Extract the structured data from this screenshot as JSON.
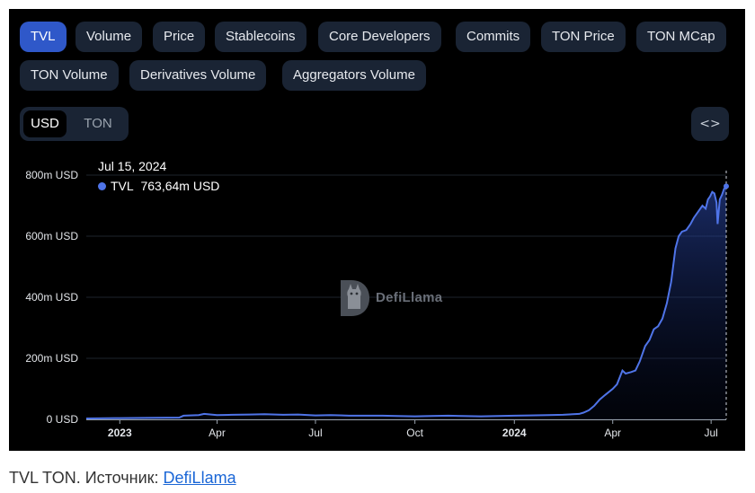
{
  "tabs": [
    "TVL",
    "Volume",
    "Price",
    "Stablecoins",
    "Core Developers",
    "Commits",
    "TON Price",
    "TON MCap",
    "TON Volume",
    "Derivatives Volume",
    "Aggregators Volume"
  ],
  "active_tab": "TVL",
  "currency_toggle": {
    "options": [
      "USD",
      "TON"
    ],
    "selected": "USD"
  },
  "embed_icon": "code-brackets-icon",
  "tooltip": {
    "date": "Jul 15, 2024",
    "series": "TVL",
    "value": "763,64m USD"
  },
  "watermark": {
    "text": "DefiLlama",
    "icon": "llama-logo-icon"
  },
  "caption": {
    "text": "TVL TON. Источник: ",
    "link_text": "DefiLlama"
  },
  "colors": {
    "line": "#4f74e8",
    "active_tab": "#2f58c9",
    "tab_bg": "#1a2434",
    "panel_bg": "#000000",
    "link": "#1a66d6"
  },
  "chart_data": {
    "type": "area",
    "series": [
      {
        "name": "TVL"
      }
    ],
    "y_ticks": [
      "0 USD",
      "200m USD",
      "400m USD",
      "600m USD",
      "800m USD"
    ],
    "y_tick_values": [
      0,
      200,
      400,
      600,
      800
    ],
    "ylim": [
      0,
      800
    ],
    "y_unit": "m USD",
    "x_ticks": [
      {
        "label": "2023",
        "date": "2023-01-01",
        "bold": true
      },
      {
        "label": "Apr",
        "date": "2023-04-01",
        "bold": false
      },
      {
        "label": "Jul",
        "date": "2023-07-01",
        "bold": false
      },
      {
        "label": "Oct",
        "date": "2023-10-01",
        "bold": false
      },
      {
        "label": "2024",
        "date": "2024-01-01",
        "bold": true
      },
      {
        "label": "Apr",
        "date": "2024-04-01",
        "bold": false
      },
      {
        "label": "Jul",
        "date": "2024-07-01",
        "bold": false
      }
    ],
    "xlim": [
      "2022-12-01",
      "2024-07-15"
    ],
    "points": [
      [
        "2022-12-01",
        3
      ],
      [
        "2023-01-01",
        4
      ],
      [
        "2023-02-01",
        5
      ],
      [
        "2023-02-25",
        6
      ],
      [
        "2023-03-01",
        12
      ],
      [
        "2023-03-15",
        14
      ],
      [
        "2023-03-20",
        18
      ],
      [
        "2023-04-01",
        14
      ],
      [
        "2023-04-15",
        15
      ],
      [
        "2023-05-01",
        16
      ],
      [
        "2023-05-15",
        17
      ],
      [
        "2023-06-01",
        15
      ],
      [
        "2023-06-15",
        16
      ],
      [
        "2023-07-01",
        13
      ],
      [
        "2023-07-15",
        14
      ],
      [
        "2023-08-01",
        12
      ],
      [
        "2023-09-01",
        12
      ],
      [
        "2023-09-15",
        11
      ],
      [
        "2023-10-01",
        10
      ],
      [
        "2023-10-15",
        11
      ],
      [
        "2023-11-01",
        12
      ],
      [
        "2023-12-01",
        10
      ],
      [
        "2024-01-01",
        12
      ],
      [
        "2024-01-15",
        13
      ],
      [
        "2024-02-01",
        14
      ],
      [
        "2024-02-15",
        15
      ],
      [
        "2024-03-01",
        18
      ],
      [
        "2024-03-05",
        22
      ],
      [
        "2024-03-10",
        30
      ],
      [
        "2024-03-15",
        45
      ],
      [
        "2024-03-20",
        65
      ],
      [
        "2024-03-25",
        80
      ],
      [
        "2024-04-01",
        100
      ],
      [
        "2024-04-05",
        115
      ],
      [
        "2024-04-10",
        160
      ],
      [
        "2024-04-13",
        150
      ],
      [
        "2024-04-18",
        155
      ],
      [
        "2024-04-22",
        160
      ],
      [
        "2024-04-26",
        190
      ],
      [
        "2024-05-01",
        240
      ],
      [
        "2024-05-05",
        260
      ],
      [
        "2024-05-09",
        295
      ],
      [
        "2024-05-13",
        305
      ],
      [
        "2024-05-17",
        330
      ],
      [
        "2024-05-21",
        380
      ],
      [
        "2024-05-25",
        450
      ],
      [
        "2024-05-29",
        560
      ],
      [
        "2024-06-01",
        600
      ],
      [
        "2024-06-04",
        615
      ],
      [
        "2024-06-08",
        620
      ],
      [
        "2024-06-12",
        640
      ],
      [
        "2024-06-15",
        660
      ],
      [
        "2024-06-19",
        680
      ],
      [
        "2024-06-23",
        700
      ],
      [
        "2024-06-26",
        690
      ],
      [
        "2024-06-28",
        720
      ],
      [
        "2024-06-30",
        730
      ],
      [
        "2024-07-02",
        745
      ],
      [
        "2024-07-04",
        740
      ],
      [
        "2024-07-06",
        710
      ],
      [
        "2024-07-07",
        640
      ],
      [
        "2024-07-09",
        720
      ],
      [
        "2024-07-11",
        735
      ],
      [
        "2024-07-13",
        755
      ],
      [
        "2024-07-15",
        763.64
      ]
    ],
    "highlight": {
      "date": "2024-07-15",
      "value": 763.64
    }
  }
}
